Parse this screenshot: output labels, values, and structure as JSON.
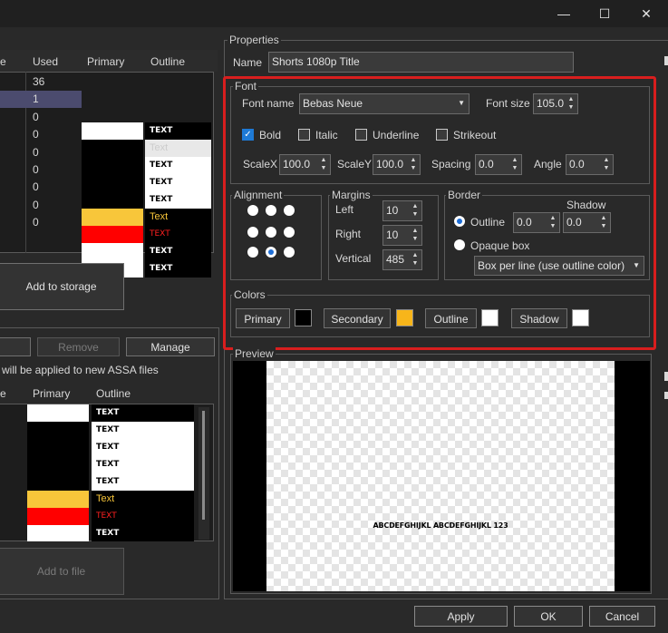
{
  "window": {
    "minimize_glyph": "—",
    "maximize_glyph": "☐",
    "close_glyph": "✕"
  },
  "left_top_table": {
    "headers": [
      "e",
      "Used",
      "Primary",
      "Outline"
    ],
    "used": [
      "36",
      "1",
      "0",
      "0",
      "0",
      "0",
      "0",
      "0",
      "0"
    ],
    "outline_text": [
      "TEXT",
      "Text",
      "TEXT",
      "TEXT",
      "TEXT",
      "Text",
      "TEXT",
      "TEXT",
      "TEXT"
    ]
  },
  "left_buttons": {
    "add_to_storage": "Add to storage",
    "remove": "Remove",
    "manage": "Manage",
    "add_to_file": "Add to file"
  },
  "left_note": "will be applied to new ASSA files",
  "left_bottom_table": {
    "headers": [
      "e",
      "Primary",
      "Outline"
    ],
    "outline_text": [
      "TEXT",
      "TEXT",
      "TEXT",
      "TEXT",
      "TEXT",
      "Text",
      "TEXT",
      "TEXT"
    ]
  },
  "properties": {
    "group_label": "Properties",
    "name_label": "Name",
    "name_value": "Shorts 1080p Title",
    "font": {
      "group_label": "Font",
      "font_name_label": "Font name",
      "font_name_value": "Bebas Neue",
      "font_size_label": "Font size",
      "font_size_value": "105.0",
      "bold": "Bold",
      "italic": "Italic",
      "underline": "Underline",
      "strikeout": "Strikeout",
      "scalex_label": "ScaleX",
      "scalex_value": "100.0",
      "scaley_label": "ScaleY",
      "scaley_value": "100.0",
      "spacing_label": "Spacing",
      "spacing_value": "0.0",
      "angle_label": "Angle",
      "angle_value": "0.0"
    },
    "alignment": {
      "group_label": "Alignment",
      "selected": 8
    },
    "margins": {
      "group_label": "Margins",
      "left_label": "Left",
      "left_value": "10",
      "right_label": "Right",
      "right_value": "10",
      "vertical_label": "Vertical",
      "vertical_value": "485"
    },
    "border": {
      "group_label": "Border",
      "shadow_label": "Shadow",
      "outline_label": "Outline",
      "outline_value": "0.0",
      "shadow_value": "0.0",
      "opaque_label": "Opaque box",
      "box_type_value": "Box per line (use outline color)"
    },
    "colors": {
      "group_label": "Colors",
      "primary": "Primary",
      "secondary": "Secondary",
      "outline": "Outline",
      "shadow": "Shadow",
      "primary_color": "#000000",
      "secondary_color": "#f7b51a",
      "outline_color": "#ffffff",
      "shadow_color": "#ffffff"
    },
    "preview": {
      "group_label": "Preview",
      "sample_text": "ABCDEFGHIJKL ABCDEFGHIJKL 123"
    }
  },
  "footer": {
    "apply": "Apply",
    "ok": "OK",
    "cancel": "Cancel"
  }
}
